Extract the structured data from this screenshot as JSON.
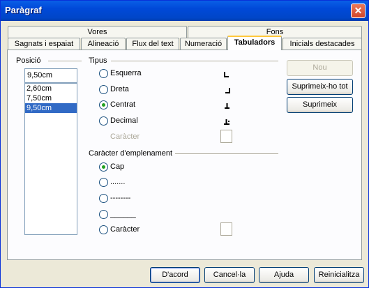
{
  "window": {
    "title": "Paràgraf"
  },
  "tabs_row1": [
    "Vores",
    "Fons"
  ],
  "tabs_row2": [
    "Sagnats i espaiat",
    "Alineació",
    "Flux del text",
    "Numeració",
    "Tabuladors",
    "Inicials destacades"
  ],
  "position": {
    "label": "Posició",
    "value": "9,50cm",
    "items": [
      "2,60cm",
      "7,50cm",
      "9,50cm"
    ],
    "selected": "9,50cm"
  },
  "type": {
    "label": "Tipus",
    "options": [
      "Esquerra",
      "Dreta",
      "Centrat",
      "Decimal"
    ],
    "selected": "Centrat",
    "char_label": "Caràcter"
  },
  "fill": {
    "label": "Caràcter d'emplenament",
    "options": [
      "Cap",
      ".......",
      "--------",
      "______",
      "Caràcter"
    ],
    "selected": "Cap"
  },
  "side_buttons": {
    "new": "Nou",
    "delete_all": "Suprimeix-ho tot",
    "delete": "Suprimeix"
  },
  "footer": {
    "ok": "D'acord",
    "cancel": "Cancel·la",
    "help": "Ajuda",
    "reset": "Reinicialitza"
  }
}
